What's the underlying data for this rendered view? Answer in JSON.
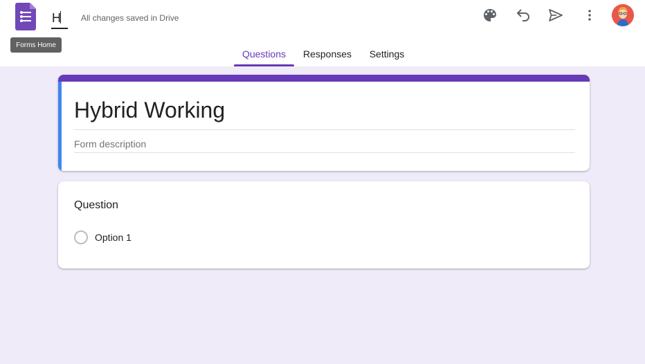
{
  "app": {
    "logo_icon": "google-forms-icon",
    "tooltip": "Forms Home",
    "title_value": "H",
    "save_status": "All changes saved in Drive",
    "accent_color": "#673ab7",
    "background_color": "#f0ebf8"
  },
  "toolbar": {
    "icons": [
      "palette-icon",
      "undo-icon",
      "send-icon",
      "more-vert-icon",
      "avatar"
    ]
  },
  "tabs": [
    {
      "label": "Questions",
      "active": true
    },
    {
      "label": "Responses",
      "active": false
    },
    {
      "label": "Settings",
      "active": false
    }
  ],
  "form": {
    "title": "Hybrid Working",
    "description_placeholder": "Form description"
  },
  "question": {
    "title": "Question",
    "options": [
      "Option 1"
    ]
  }
}
